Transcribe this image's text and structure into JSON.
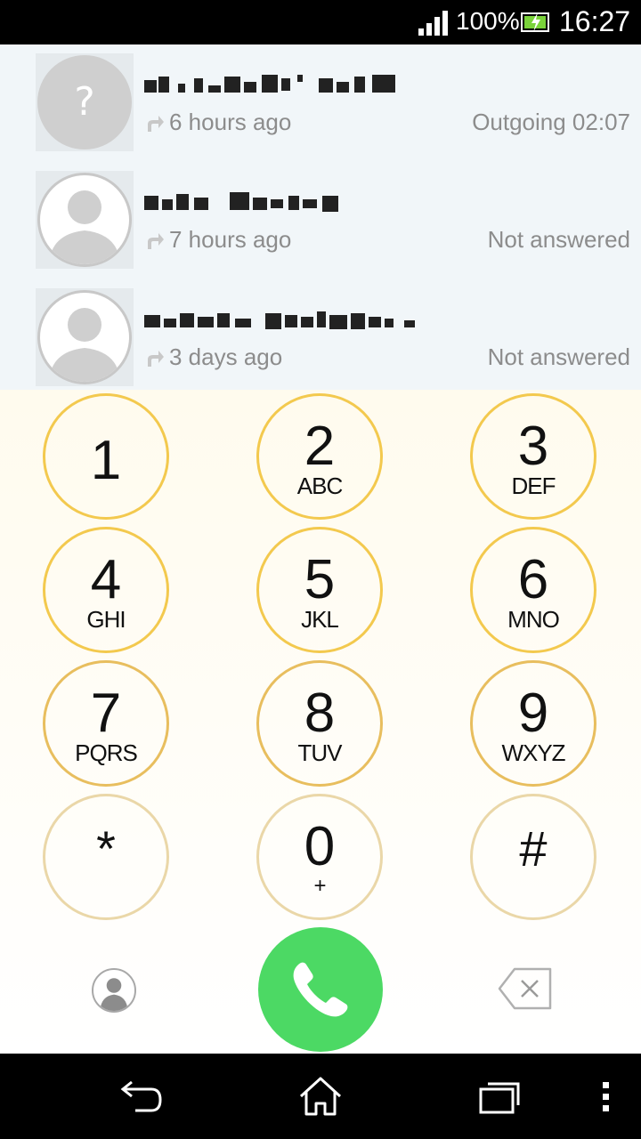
{
  "status_bar": {
    "battery_percent": "100%",
    "time": "16:27"
  },
  "call_log": [
    {
      "avatar": "unknown",
      "avatar_glyph": "?",
      "time": "6 hours ago",
      "status": "Outgoing 02:07"
    },
    {
      "avatar": "person",
      "time": "7 hours ago",
      "status": "Not answered"
    },
    {
      "avatar": "person",
      "time": "3 days ago",
      "status": "Not answered"
    }
  ],
  "dialpad": [
    {
      "digit": "1",
      "letters": ""
    },
    {
      "digit": "2",
      "letters": "ABC"
    },
    {
      "digit": "3",
      "letters": "DEF"
    },
    {
      "digit": "4",
      "letters": "GHI"
    },
    {
      "digit": "5",
      "letters": "JKL"
    },
    {
      "digit": "6",
      "letters": "MNO"
    },
    {
      "digit": "7",
      "letters": "PQRS"
    },
    {
      "digit": "8",
      "letters": "TUV"
    },
    {
      "digit": "9",
      "letters": "WXYZ"
    },
    {
      "digit": "*",
      "letters": ""
    },
    {
      "digit": "0",
      "letters": "+"
    },
    {
      "digit": "#",
      "letters": ""
    }
  ],
  "actions": {
    "contacts_icon": "contacts-icon",
    "call_icon": "phone-icon",
    "backspace_icon": "backspace-icon"
  },
  "navigation": {
    "back_icon": "back-icon",
    "home_icon": "home-icon",
    "recents_icon": "recent-apps-icon",
    "menu_icon": "overflow-menu-icon"
  },
  "colors": {
    "key_border": "#f3c94e",
    "call_button": "#4cd964",
    "log_background": "#f1f6f9"
  }
}
